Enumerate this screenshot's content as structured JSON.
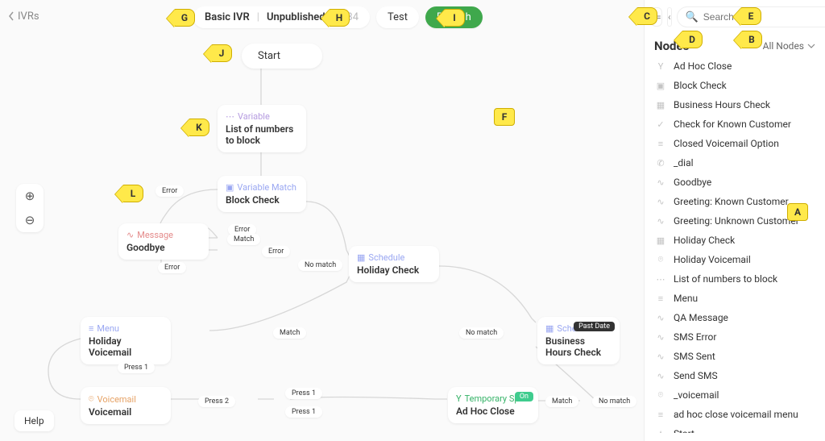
{
  "back_label": "IVRs",
  "titlebar": {
    "name": "Basic IVR",
    "status": "Unpublished",
    "timestamp": "12:34"
  },
  "buttons": {
    "test": "Test",
    "publish": "Publish"
  },
  "help_label": "Help",
  "sidebar": {
    "search_placeholder": "Search",
    "heading": "Nodes",
    "filter_label": "All Nodes",
    "items": [
      {
        "icon": "split",
        "label": "Ad Hoc Close"
      },
      {
        "icon": "match",
        "label": "Block Check"
      },
      {
        "icon": "calendar",
        "label": "Business Hours Check"
      },
      {
        "icon": "check",
        "label": "Check for Known Customer"
      },
      {
        "icon": "list",
        "label": "Closed Voicemail Option"
      },
      {
        "icon": "phone",
        "label": "_dial"
      },
      {
        "icon": "audio",
        "label": "Goodbye"
      },
      {
        "icon": "audio",
        "label": "Greeting: Known Customer"
      },
      {
        "icon": "audio",
        "label": "Greeting: Unknown Customer"
      },
      {
        "icon": "calendar",
        "label": "Holiday Check"
      },
      {
        "icon": "voicemail",
        "label": "Holiday Voicemail"
      },
      {
        "icon": "var",
        "label": "List of numbers to block"
      },
      {
        "icon": "list",
        "label": "Menu"
      },
      {
        "icon": "audio",
        "label": "QA Message"
      },
      {
        "icon": "audio",
        "label": "SMS Error"
      },
      {
        "icon": "audio",
        "label": "SMS Sent"
      },
      {
        "icon": "audio",
        "label": "Send SMS"
      },
      {
        "icon": "voicemail",
        "label": "_voicemail"
      },
      {
        "icon": "list",
        "label": "ad hoc close voicemail menu"
      },
      {
        "icon": "star",
        "label": "Start"
      }
    ]
  },
  "nodes": {
    "start": {
      "label": "Start"
    },
    "var1": {
      "type": "Variable",
      "title": "List of numbers to block"
    },
    "match": {
      "type": "Variable Match",
      "title": "Block Check"
    },
    "goodbye": {
      "type": "Message",
      "title": "Goodbye"
    },
    "holiday": {
      "type": "Schedule",
      "title": "Holiday Check"
    },
    "hvm": {
      "type": "Menu",
      "title": "Holiday Voicemail"
    },
    "bhc": {
      "type": "Schedule",
      "title": "Business Hours Check",
      "badge": "Past Date"
    },
    "ahc": {
      "type": "Temporary Split",
      "title": "Ad Hoc Close",
      "badge": "On"
    },
    "vm": {
      "type": "Voicemail",
      "title": "Voicemail"
    }
  },
  "edge_labels": {
    "error1": "Error",
    "error2": "Error",
    "match1": "Match",
    "error3": "Error",
    "nomatch1": "No match",
    "error4": "Error",
    "match2": "Match",
    "nomatch2": "No match",
    "press1a": "Press 1",
    "press2": "Press 2",
    "press1b": "Press 1",
    "press1c": "Press 1",
    "match3": "Match",
    "nomatch3": "No match"
  },
  "markers": {
    "A": "A",
    "B": "B",
    "C": "C",
    "D": "D",
    "E": "E",
    "F": "F",
    "G": "G",
    "H": "H",
    "I": "I",
    "J": "J",
    "K": "K",
    "L": "L"
  }
}
